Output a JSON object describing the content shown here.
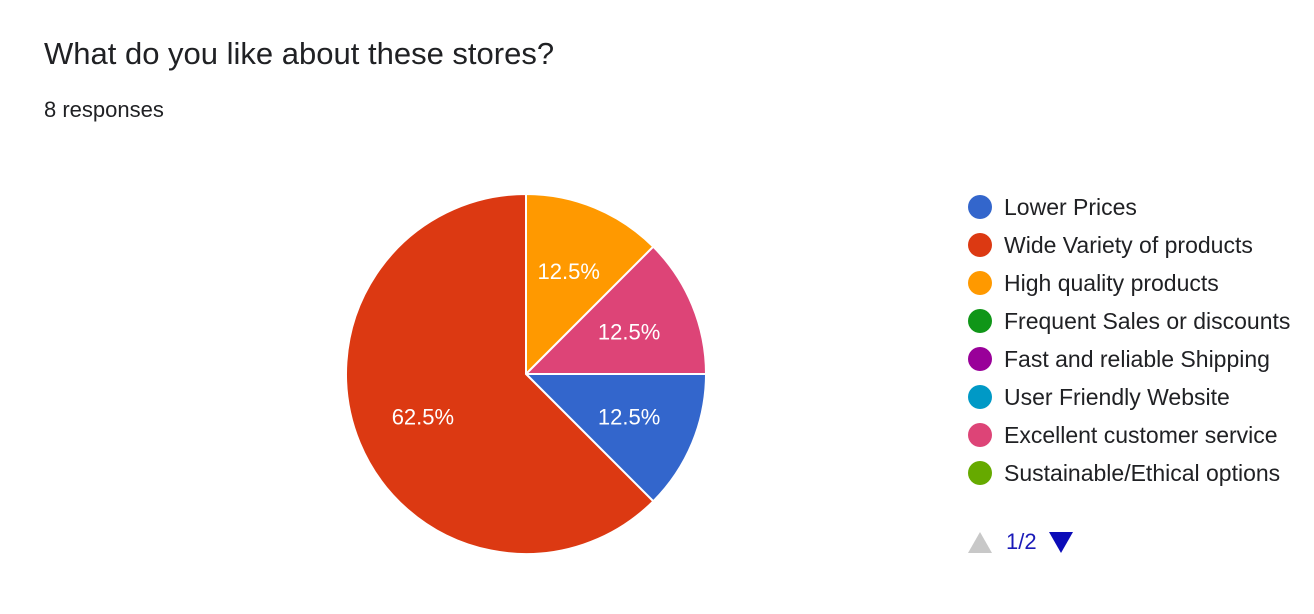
{
  "question": {
    "title": "What do you like about these stores?",
    "responses": "8 responses"
  },
  "chart_data": {
    "type": "pie",
    "categories": [
      "Lower Prices",
      "Wide Variety of products",
      "High quality products",
      "Frequent Sales or discounts",
      "Fast and reliable Shipping",
      "User Friendly Website",
      "Excellent customer service",
      "Sustainable/Ethical options"
    ],
    "values": [
      12.5,
      62.5,
      12.5,
      0,
      0,
      0,
      12.5,
      0
    ],
    "colors": [
      "#3366cc",
      "#dc3912",
      "#ff9900",
      "#109618",
      "#990099",
      "#0099c6",
      "#dd4477",
      "#66aa00"
    ],
    "slice_labels": [
      "12.5%",
      "62.5%",
      "12.5%",
      "",
      "",
      "",
      "12.5%",
      ""
    ],
    "legend_position": "right"
  },
  "pager": {
    "text": "1/2",
    "prev_icon": "triangle-up-icon",
    "next_icon": "triangle-down-icon"
  }
}
